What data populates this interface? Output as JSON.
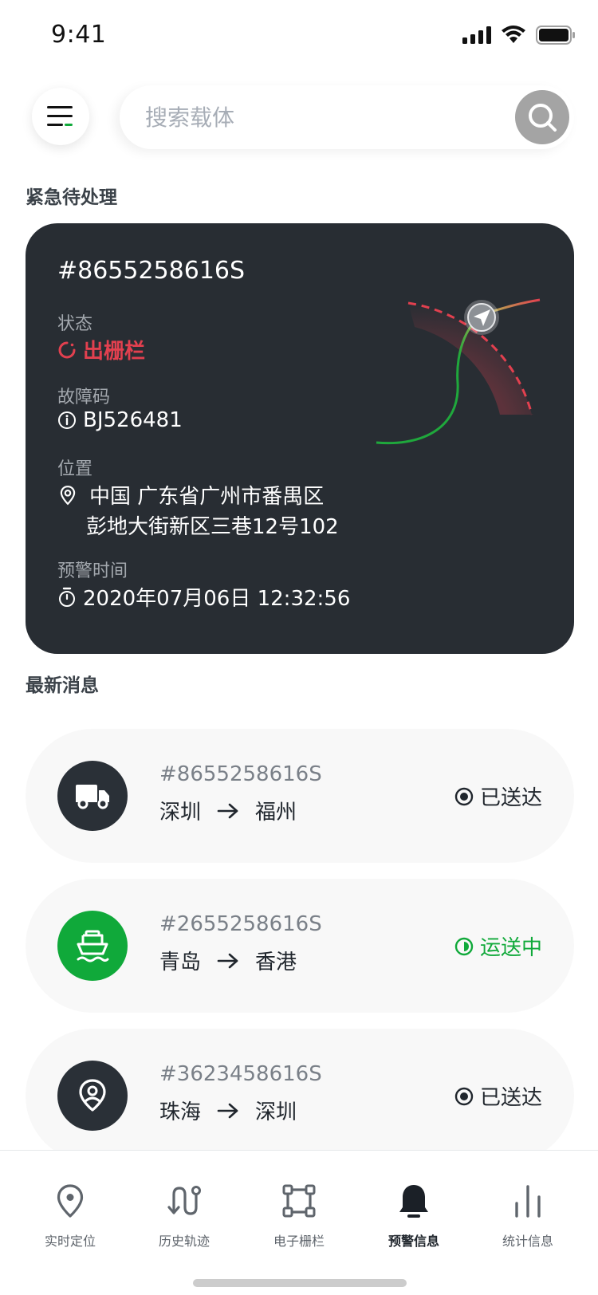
{
  "status_bar": {
    "time": "9:41"
  },
  "search": {
    "placeholder": "搜索载体"
  },
  "urgent": {
    "section_title": "紧急待处理",
    "id": "#8655258616S",
    "status_label": "状态",
    "status_value": "出栅栏",
    "fault_label": "故障码",
    "fault_value": "BJ526481",
    "location_label": "位置",
    "location_line1": "中国 广东省广州市番禺区",
    "location_line2": "彭地大街新区三巷12号102",
    "time_label": "预警时间",
    "time_value": "2020年07月06日 12:32:56",
    "colors": {
      "alert": "#e2404f",
      "track": "#1fa83c"
    }
  },
  "messages": {
    "section_title": "最新消息",
    "items": [
      {
        "id": "#8655258616S",
        "from": "深圳",
        "to": "福州",
        "status": "已送达",
        "icon": "truck-icon"
      },
      {
        "id": "#2655258616S",
        "from": "青岛",
        "to": "香港",
        "status": "运送中",
        "icon": "ship-icon"
      },
      {
        "id": "#3623458616S",
        "from": "珠海",
        "to": "深圳",
        "status": "已送达",
        "icon": "pin-icon"
      }
    ]
  },
  "tabs": [
    {
      "label": "实时定位",
      "icon": "location-pin-icon"
    },
    {
      "label": "历史轨迹",
      "icon": "route-icon"
    },
    {
      "label": "电子栅栏",
      "icon": "fence-icon"
    },
    {
      "label": "预警信息",
      "icon": "bell-icon",
      "active": true
    },
    {
      "label": "统计信息",
      "icon": "bar-chart-icon"
    }
  ]
}
